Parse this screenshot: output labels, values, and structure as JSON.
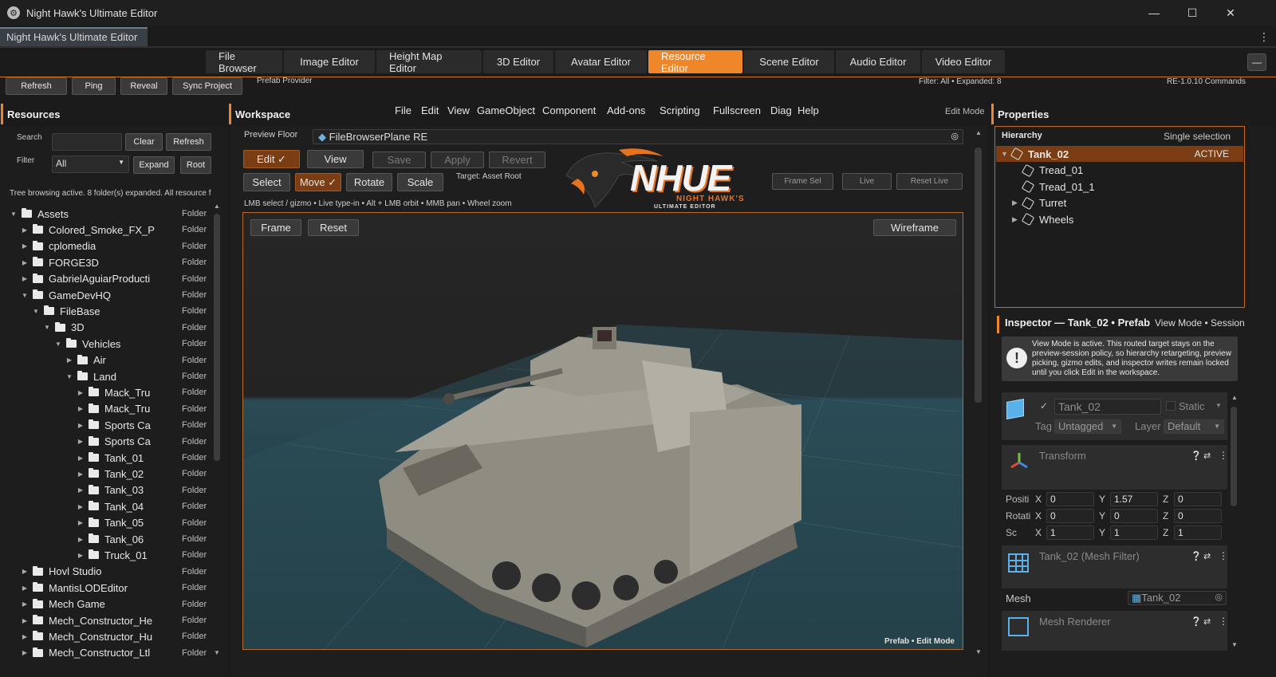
{
  "window": {
    "title": "Night Hawk's Ultimate Editor",
    "doc_tab": "Night Hawk's Ultimate Editor"
  },
  "editor_tabs": [
    "File Browser",
    "Image Editor",
    "Height Map Editor",
    "3D Editor",
    "Avatar Editor",
    "Resource Editor",
    "Scene Editor",
    "Audio Editor",
    "Video Editor"
  ],
  "active_tab": "Resource Editor",
  "toolbar": {
    "refresh": "Refresh",
    "ping": "Ping",
    "reveal": "Reveal",
    "sync": "Sync Project",
    "provider": "Prefab Provider",
    "filter_status": "Filter: All • Expanded: 8",
    "version": "RE-1.0.10 Commands"
  },
  "resources": {
    "title": "Resources",
    "search_label": "Search",
    "clear": "Clear",
    "refresh": "Refresh",
    "filter_label": "Filter",
    "filter_value": "All",
    "expand": "Expand",
    "root": "Root",
    "status": "Tree browsing active. 8 folder(s) expanded. All resource f",
    "items": [
      {
        "name": "Assets",
        "depth": 0,
        "open": true,
        "kind": "Folder"
      },
      {
        "name": "Colored_Smoke_FX_P",
        "depth": 1,
        "open": false,
        "kind": "Folder"
      },
      {
        "name": "cplomedia",
        "depth": 1,
        "open": false,
        "kind": "Folder"
      },
      {
        "name": "FORGE3D",
        "depth": 1,
        "open": false,
        "kind": "Folder"
      },
      {
        "name": "GabrielAguiarProducti",
        "depth": 1,
        "open": false,
        "kind": "Folder"
      },
      {
        "name": "GameDevHQ",
        "depth": 1,
        "open": true,
        "kind": "Folder"
      },
      {
        "name": "FileBase",
        "depth": 2,
        "open": true,
        "kind": "Folder"
      },
      {
        "name": "3D",
        "depth": 3,
        "open": true,
        "kind": "Folder"
      },
      {
        "name": "Vehicles",
        "depth": 4,
        "open": true,
        "kind": "Folder"
      },
      {
        "name": "Air",
        "depth": 5,
        "open": false,
        "kind": "Folder"
      },
      {
        "name": "Land",
        "depth": 5,
        "open": true,
        "kind": "Folder"
      },
      {
        "name": "Mack_Tru",
        "depth": 6,
        "open": false,
        "kind": "Folder"
      },
      {
        "name": "Mack_Tru",
        "depth": 6,
        "open": false,
        "kind": "Folder"
      },
      {
        "name": "Sports Ca",
        "depth": 6,
        "open": false,
        "kind": "Folder"
      },
      {
        "name": "Sports Ca",
        "depth": 6,
        "open": false,
        "kind": "Folder"
      },
      {
        "name": "Tank_01",
        "depth": 6,
        "open": false,
        "kind": "Folder"
      },
      {
        "name": "Tank_02",
        "depth": 6,
        "open": false,
        "kind": "Folder"
      },
      {
        "name": "Tank_03",
        "depth": 6,
        "open": false,
        "kind": "Folder"
      },
      {
        "name": "Tank_04",
        "depth": 6,
        "open": false,
        "kind": "Folder"
      },
      {
        "name": "Tank_05",
        "depth": 6,
        "open": false,
        "kind": "Folder"
      },
      {
        "name": "Tank_06",
        "depth": 6,
        "open": false,
        "kind": "Folder"
      },
      {
        "name": "Truck_01",
        "depth": 6,
        "open": false,
        "kind": "Folder"
      },
      {
        "name": "Hovl Studio",
        "depth": 1,
        "open": false,
        "kind": "Folder"
      },
      {
        "name": "MantisLODEditor",
        "depth": 1,
        "open": false,
        "kind": "Folder"
      },
      {
        "name": "Mech Game",
        "depth": 1,
        "open": false,
        "kind": "Folder"
      },
      {
        "name": "Mech_Constructor_He",
        "depth": 1,
        "open": false,
        "kind": "Folder"
      },
      {
        "name": "Mech_Constructor_Hu",
        "depth": 1,
        "open": false,
        "kind": "Folder"
      },
      {
        "name": "Mech_Constructor_Ltl",
        "depth": 1,
        "open": false,
        "kind": "Folder"
      }
    ]
  },
  "workspace": {
    "title": "Workspace",
    "menu": [
      "File",
      "Edit",
      "View",
      "GameObject",
      "Component",
      "Add-ons",
      "Scripting",
      "Fullscreen",
      "Diag",
      "Help"
    ],
    "mode": "Edit Mode",
    "preview_floor_label": "Preview Floor",
    "preview_floor_value": "FileBrowserPlane RE",
    "edit": "Edit ✓",
    "view": "View",
    "save": "Save",
    "apply": "Apply",
    "revert": "Revert",
    "select": "Select",
    "move": "Move ✓",
    "rotate": "Rotate",
    "scale": "Scale",
    "target": "Target: Asset Root",
    "frame_sel": "Frame Sel",
    "live": "Live",
    "reset_live": "Reset Live",
    "hints": [
      "LMB select / gizmo",
      "Live type-in",
      "Alt + LMB orbit",
      "MMB pan",
      "Wheel zoom"
    ],
    "frame": "Frame",
    "reset": "Reset",
    "wireframe": "Wireframe",
    "footer": "Prefab • Edit Mode",
    "logo": {
      "main": "NHUE",
      "sub1": "NIGHT HAWK'S",
      "sub2": "ULTIMATE EDITOR"
    }
  },
  "properties": {
    "title": "Properties",
    "hierarchy_label": "Hierarchy",
    "selection": "Single selection",
    "hierarchy": [
      {
        "name": "Tank_02",
        "depth": 0,
        "badge": "ACTIVE",
        "selected": true,
        "arrow": "▼"
      },
      {
        "name": "Tread_01",
        "depth": 1,
        "badge": "",
        "selected": false,
        "arrow": ""
      },
      {
        "name": "Tread_01_1",
        "depth": 1,
        "badge": "",
        "selected": false,
        "arrow": ""
      },
      {
        "name": "Turret",
        "depth": 1,
        "badge": "",
        "selected": false,
        "arrow": "▶"
      },
      {
        "name": "Wheels",
        "depth": 1,
        "badge": "",
        "selected": false,
        "arrow": "▶"
      }
    ],
    "inspector_title": "Inspector — Tank_02 • Prefab",
    "inspector_mode": "View Mode • Session",
    "notice": "View Mode is active. This routed target stays on the preview-session policy, so hierarchy retargeting, preview picking, gizmo edits, and inspector writes remain locked until you click Edit in the workspace.",
    "object_name": "Tank_02",
    "static": "Static",
    "tag_label": "Tag",
    "tag": "Untagged",
    "layer_label": "Layer",
    "layer": "Default",
    "transform": "Transform",
    "position_label": "Positi",
    "rotation_label": "Rotati",
    "scale_label": "Sc",
    "position": [
      "0",
      "1.57",
      "0"
    ],
    "rotation": [
      "0",
      "0",
      "0"
    ],
    "scale": [
      "1",
      "1",
      "1"
    ],
    "mesh_filter": "Tank_02 (Mesh Filter)",
    "mesh_label": "Mesh",
    "mesh_value": "Tank_02",
    "mesh_renderer": "Mesh Renderer"
  }
}
